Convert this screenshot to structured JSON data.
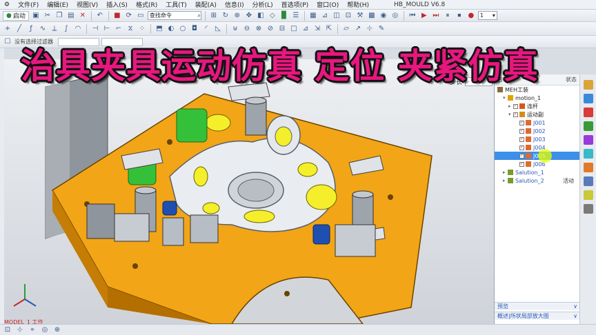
{
  "menu": {
    "items": [
      "文件(F)",
      "编辑(E)",
      "视图(V)",
      "插入(S)",
      "格式(R)",
      "工具(T)",
      "装配(A)",
      "信息(I)",
      "分析(L)",
      "首选项(P)",
      "窗口(O)",
      "帮助(H)"
    ],
    "title": "HB_MOULD V6.8"
  },
  "toolbar": {
    "start_label": "启动",
    "command_search_placeholder": "查找命令",
    "page_select": "1"
  },
  "toolbar3": {
    "prompt": "没有选择过滤器"
  },
  "banner": {
    "text": "治具夹具运动仿真 定位 夹紧仿真"
  },
  "step": {
    "label": "步长",
    "value": "0"
  },
  "navigator": {
    "col_name": "名称",
    "col_status": "状态",
    "rows": [
      {
        "name": "MEH工装",
        "level": 0,
        "checked": false,
        "icon": "assembly-icon"
      },
      {
        "name": "motion_1",
        "level": 1,
        "checked": false,
        "icon": "motion-icon"
      },
      {
        "name": "连杆",
        "level": 2,
        "checked": true,
        "icon": "link-icon"
      },
      {
        "name": "运动副",
        "level": 2,
        "checked": true,
        "icon": "joint-group-icon"
      },
      {
        "name": "J001",
        "level": 3,
        "checked": true,
        "icon": "joint-icon"
      },
      {
        "name": "J002",
        "level": 3,
        "checked": true,
        "icon": "joint-icon"
      },
      {
        "name": "J003",
        "level": 3,
        "checked": true,
        "icon": "joint-icon"
      },
      {
        "name": "J004",
        "level": 3,
        "checked": true,
        "icon": "joint-icon"
      },
      {
        "name": "J005",
        "level": 3,
        "checked": true,
        "icon": "joint-icon",
        "selected": true
      },
      {
        "name": "J006",
        "level": 3,
        "checked": true,
        "icon": "joint-icon"
      },
      {
        "name": "Salution_1",
        "level": 1,
        "checked": false,
        "icon": "solution-icon"
      },
      {
        "name": "Salution_2",
        "level": 1,
        "checked": false,
        "icon": "solution-icon",
        "status": "活动"
      }
    ],
    "preview_label": "预览",
    "footer_label": "概述|所状局部放大图"
  },
  "viewport": {
    "model_label": "MODEL_1 工作"
  },
  "colors": {
    "banner": "#e8177f",
    "plate": "#f2a516",
    "accent_yellow": "#f4ef2a",
    "accent_green": "#35c03a",
    "selection": "#3d8fe8"
  }
}
